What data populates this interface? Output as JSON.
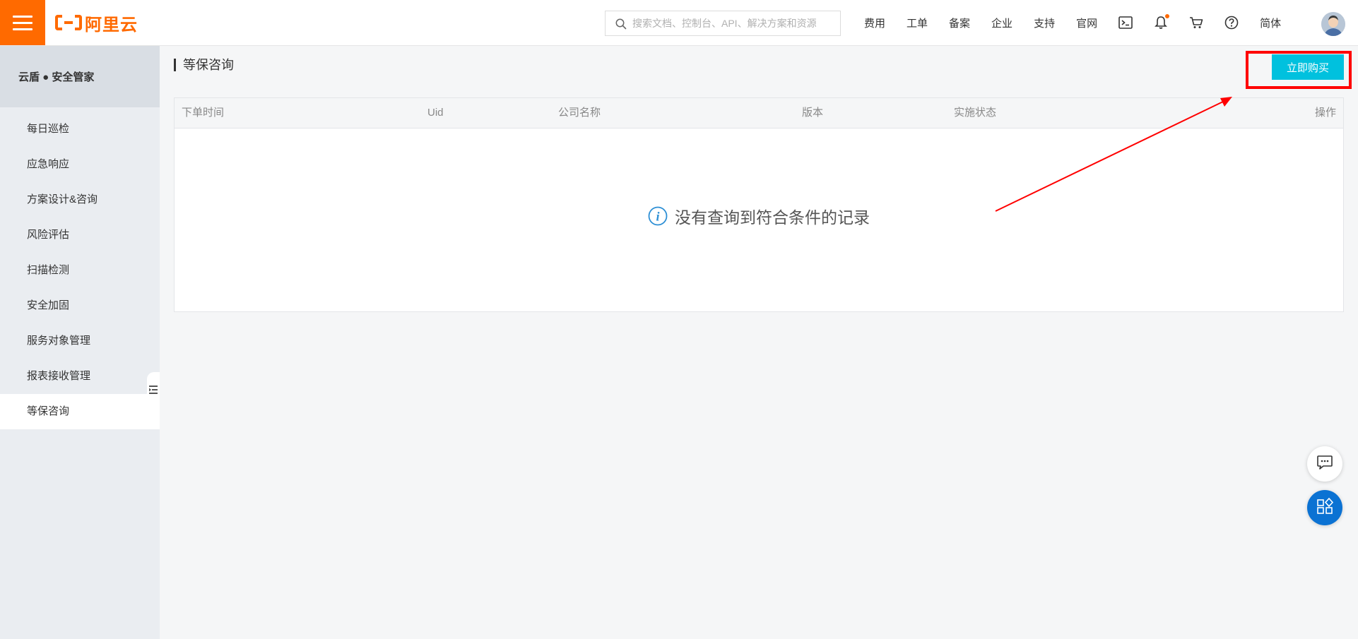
{
  "header": {
    "logo_text": "阿里云",
    "search_placeholder": "搜索文档、控制台、API、解决方案和资源",
    "nav": [
      "费用",
      "工单",
      "备案",
      "企业",
      "支持",
      "官网"
    ],
    "language": "简体"
  },
  "sidebar": {
    "title": "云盾 ● 安全管家",
    "items": [
      {
        "label": "每日巡检"
      },
      {
        "label": "应急响应"
      },
      {
        "label": "方案设计&咨询"
      },
      {
        "label": "风险评估"
      },
      {
        "label": "扫描检测"
      },
      {
        "label": "安全加固"
      },
      {
        "label": "服务对象管理"
      },
      {
        "label": "报表接收管理"
      },
      {
        "label": "等保咨询"
      }
    ],
    "active_item": "等保咨询"
  },
  "main": {
    "page_title": "等保咨询",
    "buy_button": "立即购买",
    "table": {
      "columns": [
        "下单时间",
        "Uid",
        "公司名称",
        "版本",
        "实施状态",
        "操作"
      ],
      "rows": []
    },
    "empty_text": "没有查询到符合条件的记录"
  },
  "colors": {
    "brand_orange": "#ff6a00",
    "buy_button": "#00c1de",
    "annotation_red": "#ff0000",
    "apps_button": "#0b72d3"
  },
  "icons": [
    "menu-icon",
    "search-icon",
    "terminal-icon",
    "bell-icon",
    "cart-icon",
    "help-icon",
    "collapse-icon",
    "info-icon",
    "chat-icon",
    "apps-icon"
  ]
}
